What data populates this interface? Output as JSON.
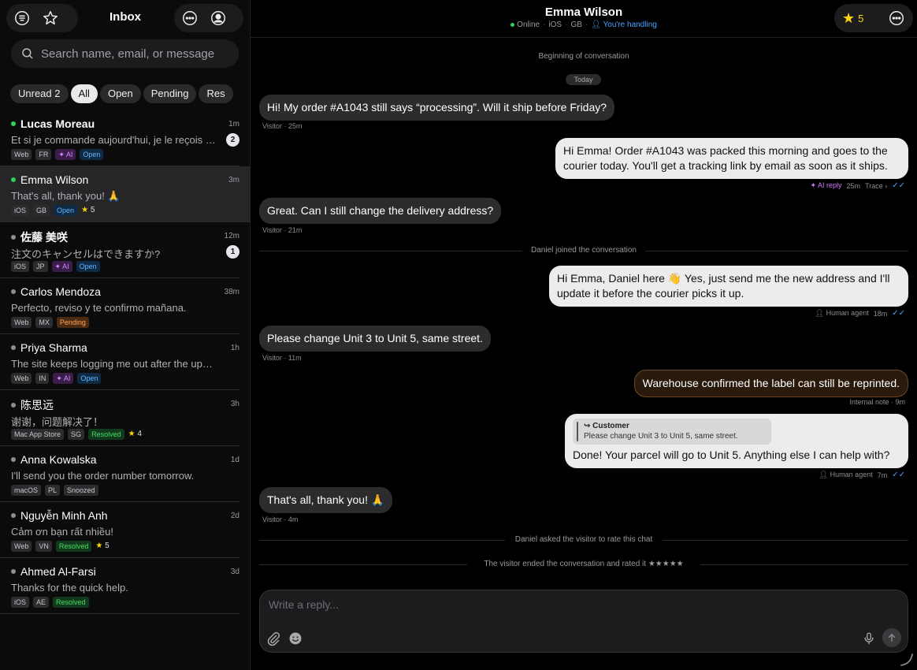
{
  "sidebar": {
    "title": "Inbox",
    "search_placeholder": "Search name, email, or message",
    "filters": [
      {
        "label": "Unread",
        "count": "2"
      },
      {
        "label": "All"
      },
      {
        "label": "Open"
      },
      {
        "label": "Pending"
      },
      {
        "label": "Res"
      }
    ],
    "conversations": [
      {
        "name": "Lucas Moreau",
        "time": "1m",
        "preview": "Et si je commande aujourd'hui, je le reçois q...",
        "badge": "2",
        "tags": [
          "Web",
          "FR",
          "AI",
          "Open"
        ]
      },
      {
        "name": "Emma Wilson",
        "time": "3m",
        "preview": "That's all, thank you! 🙏",
        "tags": [
          "iOS",
          "GB",
          "Open"
        ],
        "rating": "5"
      },
      {
        "name": "佐藤 美咲",
        "time": "12m",
        "preview": "注文のキャンセルはできますか?",
        "badge": "1",
        "tags": [
          "iOS",
          "JP",
          "AI",
          "Open"
        ]
      },
      {
        "name": "Carlos Mendoza",
        "time": "38m",
        "preview": "Perfecto, reviso y te confirmo mañana.",
        "tags": [
          "Web",
          "MX",
          "Pending"
        ]
      },
      {
        "name": "Priya Sharma",
        "time": "1h",
        "preview": "The site keeps logging me out after the update.",
        "tags": [
          "Web",
          "IN",
          "AI",
          "Open"
        ]
      },
      {
        "name": "陈思远",
        "time": "3h",
        "preview": "谢谢，问题解决了！",
        "tags": [
          "Mac App Store",
          "SG",
          "Resolved"
        ],
        "rating": "4"
      },
      {
        "name": "Anna Kowalska",
        "time": "1d",
        "preview": "I'll send you the order number tomorrow.",
        "tags": [
          "macOS",
          "PL",
          "Snoozed"
        ]
      },
      {
        "name": "Nguyễn Minh Anh",
        "time": "2d",
        "preview": "Cảm ơn bạn rất nhiều!",
        "tags": [
          "Web",
          "VN",
          "Resolved"
        ],
        "rating": "5"
      },
      {
        "name": "Ahmed Al-Farsi",
        "time": "3d",
        "preview": "Thanks for the quick help.",
        "tags": [
          "iOS",
          "AE",
          "Resolved"
        ]
      }
    ]
  },
  "header": {
    "name": "Emma Wilson",
    "status": "Online",
    "platform": "iOS",
    "country": "GB",
    "handling": "You're handling",
    "rating": "5"
  },
  "thread": {
    "beginning": "Beginning of conversation",
    "day": "Today",
    "m1": {
      "text": "Hi! My order #A1043 still says “processing”. Will it ship before Friday?",
      "meta": "Visitor · 25m"
    },
    "m2": {
      "text": "Hi Emma! Order #A1043 was packed this morning and goes to the courier today. You'll get a tracking link by email as soon as it ships.",
      "ai": "AI reply",
      "time": "25m",
      "trace": "Trace"
    },
    "m3": {
      "text": "Great. Can I still change the delivery address?",
      "meta": "Visitor · 21m"
    },
    "joined": "Daniel joined the conversation",
    "m4": {
      "text": "Hi Emma, Daniel here 👋 Yes, just send me the new address and I'll update it before the courier picks it up.",
      "agent": "Human agent",
      "time": "18m"
    },
    "m5": {
      "text": "Please change Unit 3 to Unit 5, same street.",
      "meta": "Visitor · 11m"
    },
    "note": {
      "text": "Warehouse confirmed the label can still be reprinted.",
      "meta": "Internal note · 9m"
    },
    "m6": {
      "quote_title": "Customer",
      "quote_text": "Please change Unit 3 to Unit 5, same street.",
      "text": "Done! Your parcel will go to Unit 5. Anything else I can help with?",
      "agent": "Human agent",
      "time": "7m"
    },
    "m7": {
      "text": "That's all, thank you! 🙏",
      "meta": "Visitor · 4m"
    },
    "asked": "Daniel asked the visitor to rate this chat",
    "ended": "The visitor ended the conversation and rated it ★★★★★"
  },
  "composer": {
    "placeholder": "Write a reply..."
  },
  "colors": {
    "accent_blue": "#4aa3ff",
    "online_green": "#30d158",
    "star_yellow": "#ffd60a",
    "ai_purple": "#d78bff"
  }
}
